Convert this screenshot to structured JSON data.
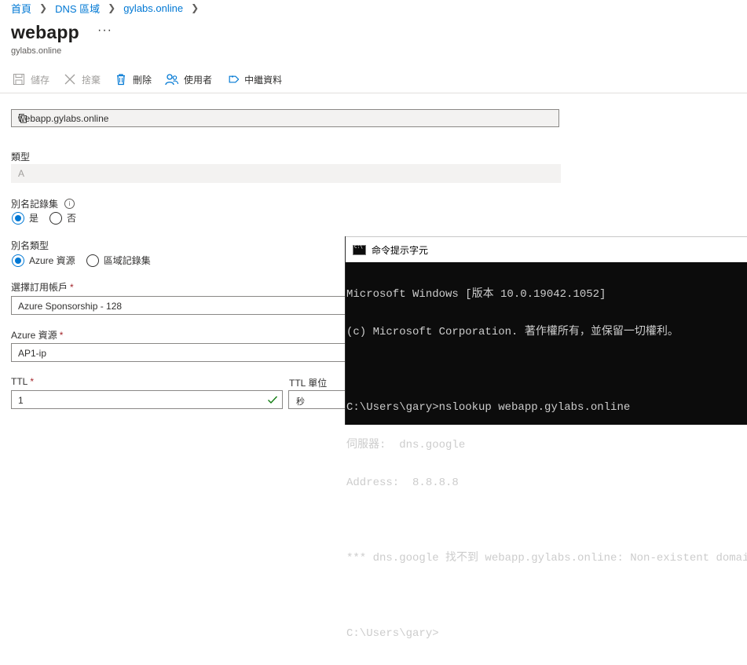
{
  "breadcrumb": [
    {
      "label": "首頁"
    },
    {
      "label": "DNS 區域"
    },
    {
      "label": "gylabs.online"
    }
  ],
  "header": {
    "title": "webapp",
    "more": "···",
    "subtitle": "gylabs.online"
  },
  "toolbar": {
    "save": "儲存",
    "discard": "捨棄",
    "delete": "刪除",
    "users": "使用者",
    "metadata": "中繼資料"
  },
  "form": {
    "fqdn": "webapp.gylabs.online",
    "type_label": "類型",
    "type_value": "A",
    "alias_label": "別名記錄集",
    "alias_yes": "是",
    "alias_no": "否",
    "alias_selected": "yes",
    "alias_type_label": "別名類型",
    "alias_type_azure": "Azure 資源",
    "alias_type_zone": "區域記錄集",
    "alias_type_selected": "azure",
    "subscription_label": "選擇訂用帳戶",
    "subscription_value": "Azure Sponsorship - 128",
    "resource_label": "Azure 資源",
    "resource_value": "AP1-ip",
    "ttl_label": "TTL",
    "ttl_value": "1",
    "ttl_unit_label": "TTL 單位",
    "ttl_unit_value": "秒",
    "required_mark": "*"
  },
  "cmd": {
    "title": "命令提示字元",
    "lines": [
      "Microsoft Windows [版本 10.0.19042.1052]",
      "(c) Microsoft Corporation. 著作權所有，並保留一切權利。",
      "",
      "C:\\Users\\gary>nslookup webapp.gylabs.online",
      "伺服器:  dns.google",
      "Address:  8.8.8.8",
      "",
      "*** dns.google 找不到 webapp.gylabs.online: Non-existent domain",
      "",
      "C:\\Users\\gary>"
    ]
  },
  "colors": {
    "accent": "#0078d4",
    "required": "#a4262c",
    "valid": "#107c10",
    "cmd_background": "#0c0c0c",
    "cmd_text": "#cccccc"
  }
}
